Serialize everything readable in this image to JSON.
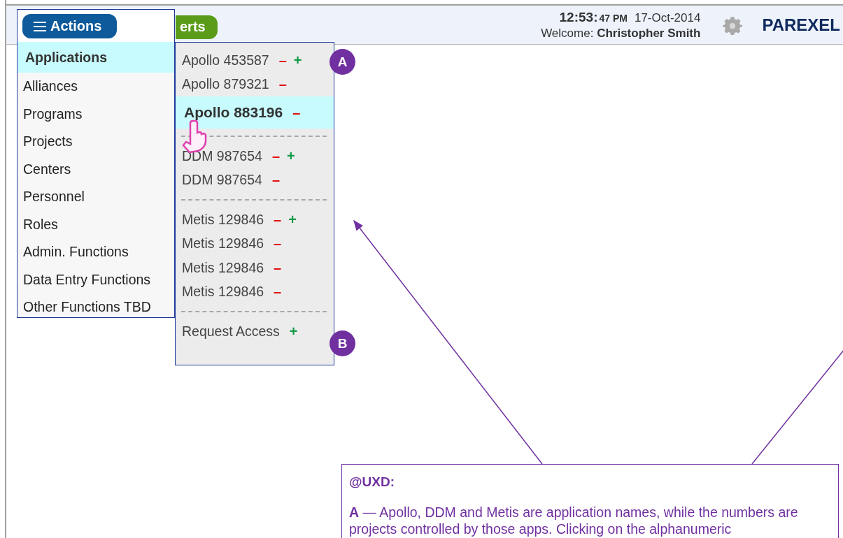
{
  "top_bar": {
    "actions_button": {
      "label": "Actions"
    },
    "partial_button": {
      "label": "erts"
    },
    "time": "12:53:",
    "seconds": "47 PM",
    "date": "17-Oct-2014",
    "welcome": "Welcome: **Christopher Smith**",
    "brand": "PAREXEL"
  },
  "menu": {
    "items": [
      {
        "label": "Applications",
        "selected": true
      },
      {
        "label": "Alliances",
        "selected": false
      },
      {
        "label": "Programs",
        "selected": false
      },
      {
        "label": "Projects",
        "selected": false
      },
      {
        "label": "Centers",
        "selected": false
      },
      {
        "label": "Personnel",
        "selected": false
      },
      {
        "label": "Roles",
        "selected": false
      },
      {
        "label": "Admin. Functions",
        "selected": false
      },
      {
        "label": "Data Entry Functions",
        "selected": false
      },
      {
        "label": "Other Functions TBD",
        "selected": false
      }
    ]
  },
  "submenu": {
    "groups": [
      {
        "items": [
          {
            "label": "Apollo 453587",
            "selected": false,
            "symbols": [
              {
                "kind": "remove",
                "text": "–"
              },
              {
                "kind": "add",
                "text": "+"
              }
            ]
          },
          {
            "label": "Apollo 879321",
            "selected": false,
            "symbols": [
              {
                "kind": "remove",
                "text": "–"
              }
            ]
          },
          {
            "label": "Apollo 883196",
            "selected": true,
            "symbols": [
              {
                "kind": "remove",
                "text": "–"
              }
            ]
          }
        ]
      },
      {
        "items": [
          {
            "label": "DDM 987654",
            "selected": false,
            "symbols": [
              {
                "kind": "remove",
                "text": "–"
              },
              {
                "kind": "add",
                "text": "+"
              }
            ]
          },
          {
            "label": "DDM 987654",
            "selected": false,
            "symbols": [
              {
                "kind": "remove",
                "text": "–"
              }
            ]
          }
        ]
      },
      {
        "items": [
          {
            "label": "Metis 129846",
            "selected": false,
            "symbols": [
              {
                "kind": "remove",
                "text": "–"
              },
              {
                "kind": "add",
                "text": "+"
              }
            ]
          },
          {
            "label": "Metis 129846",
            "selected": false,
            "symbols": [
              {
                "kind": "remove",
                "text": "–"
              }
            ]
          },
          {
            "label": "Metis 129846",
            "selected": false,
            "symbols": [
              {
                "kind": "remove",
                "text": "–"
              }
            ]
          },
          {
            "label": "Metis 129846",
            "selected": false,
            "symbols": [
              {
                "kind": "remove",
                "text": "–"
              }
            ]
          }
        ]
      },
      {
        "items": [
          {
            "label": "Request Access",
            "selected": false,
            "symbols": [
              {
                "kind": "add",
                "text": "+"
              }
            ]
          }
        ]
      }
    ]
  },
  "badges": [
    "A",
    "B"
  ],
  "note": {
    "title": "@UXD:",
    "text": "**A** — Apollo, DDM and Metis are application names, while the numbers are projects controlled by those apps. Clicking on the alphanumeric"
  }
}
